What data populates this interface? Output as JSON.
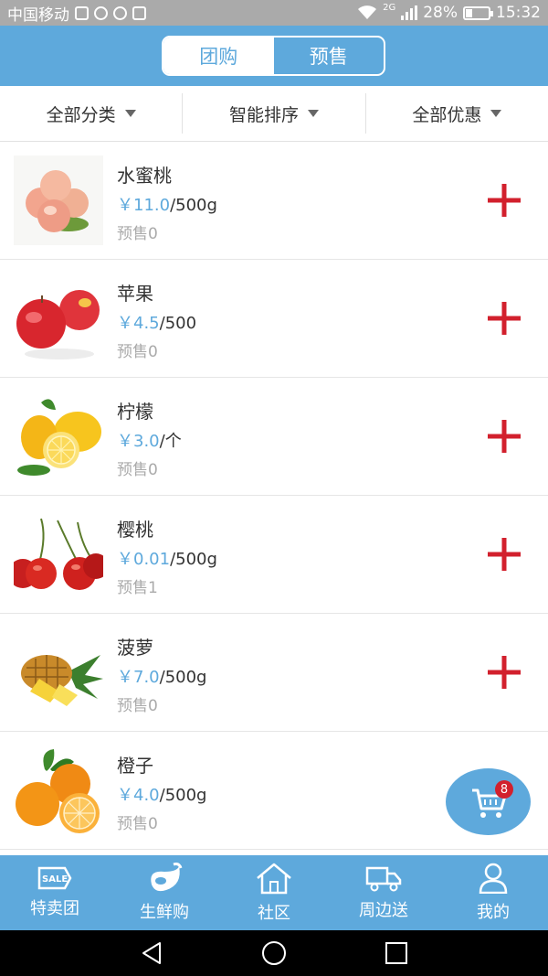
{
  "status_bar": {
    "carrier": "中国移动",
    "network": "2G",
    "battery": "28%",
    "battery_level": 0.28,
    "time": "15:32"
  },
  "header": {
    "tabs": [
      {
        "label": "团购",
        "active": true
      },
      {
        "label": "预售",
        "active": false
      }
    ]
  },
  "filters": [
    {
      "label": "全部分类"
    },
    {
      "label": "智能排序"
    },
    {
      "label": "全部优惠"
    }
  ],
  "products": [
    {
      "name": "水蜜桃",
      "price": "￥11.0",
      "unit": "/500g",
      "presale": "预售0",
      "image": "peach"
    },
    {
      "name": "苹果",
      "price": "￥4.5",
      "unit": "/500",
      "presale": "预售0",
      "image": "apple"
    },
    {
      "name": "柠檬",
      "price": "￥3.0",
      "unit": "/个",
      "presale": "预售0",
      "image": "lemon"
    },
    {
      "name": "樱桃",
      "price": "￥0.01",
      "unit": "/500g",
      "presale": "预售1",
      "image": "cherry"
    },
    {
      "name": "菠萝",
      "price": "￥7.0",
      "unit": "/500g",
      "presale": "预售0",
      "image": "pineapple"
    },
    {
      "name": "橙子",
      "price": "￥4.0",
      "unit": "/500g",
      "presale": "预售0",
      "image": "orange"
    }
  ],
  "cart": {
    "badge": "8",
    "icon": "cart-icon"
  },
  "bottom_nav": [
    {
      "label": "特卖团",
      "icon": "sale-icon",
      "icon_text": "SALE"
    },
    {
      "label": "生鲜购",
      "icon": "eggplant-icon"
    },
    {
      "label": "社区",
      "icon": "house-icon"
    },
    {
      "label": "周边送",
      "icon": "truck-icon"
    },
    {
      "label": "我的",
      "icon": "user-icon"
    }
  ],
  "colors": {
    "accent": "#5ea9dc",
    "add_button": "#d2202d",
    "presale_text": "#aaaaaa",
    "status_bar": "#aaaaaa"
  }
}
